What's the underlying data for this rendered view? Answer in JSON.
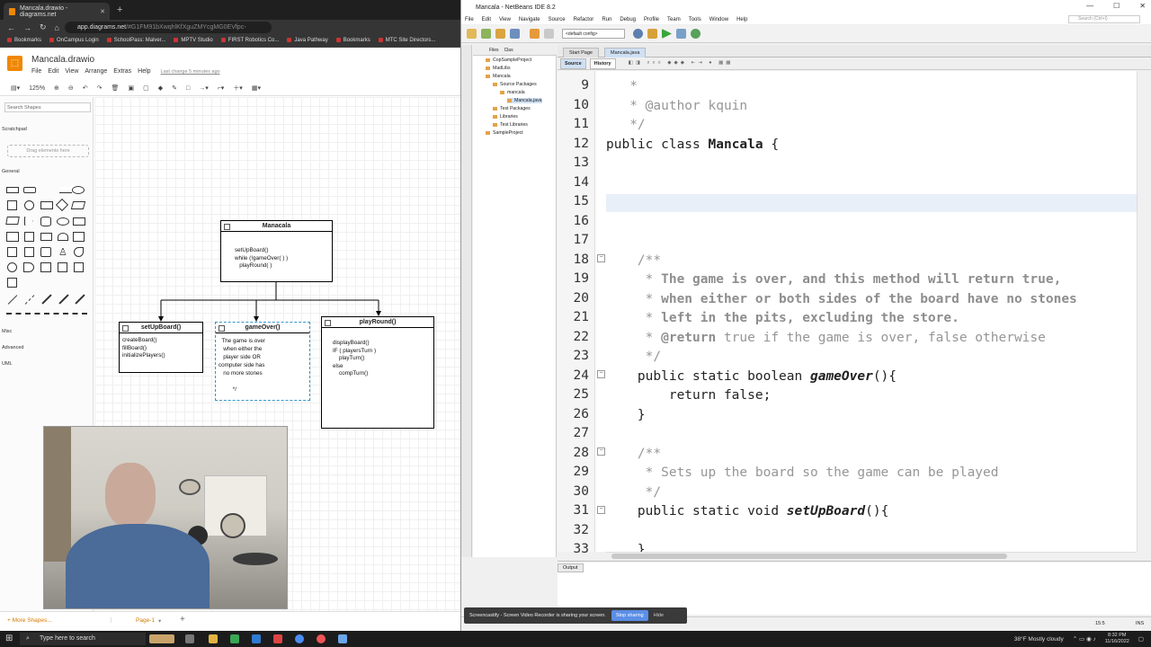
{
  "browser": {
    "tab_title": "Mancala.drawio - diagrams.net",
    "url_host": "app.diagrams.net",
    "url_rest": "/#G1FM91bXwqhlKfXguZMYcgMG0EVfpc-",
    "bookmarks": [
      "Bookmarks",
      "OnCampus Login",
      "SchoolPass: Malver...",
      "MPTV Studio",
      "FIRST Robotics Co...",
      "Java Pathway",
      "Bookmarks",
      "MTC Site Directors..."
    ]
  },
  "drawio": {
    "doc_title": "Mancala.drawio",
    "menu": [
      "File",
      "Edit",
      "View",
      "Arrange",
      "Extras",
      "Help"
    ],
    "last_change": "Last change 5 minutes ago",
    "zoom": "125%",
    "search_placeholder": "Search Shapes",
    "scratchpad": "Scratchpad",
    "drag_here": "Drag elements here",
    "general": "General",
    "misc": "Misc",
    "advanced": "Advanced",
    "uml": "UML",
    "more_shapes": "+ More Shapes...",
    "page": "Page-1",
    "boxes": {
      "main": {
        "title": "Manacala",
        "body": "setUpBoard()\nwhile (!gameOver( ) )\n   playRound( )"
      },
      "setup": {
        "title": "setUpBoard()",
        "body": "createBoard()\nfillBoard()\ninitializePlayers()"
      },
      "gameover": {
        "title": "gameOver()",
        "body": "  The game is over\n   when either the\n   player side OR\ncomputer side has\n   no more stones\n\n         */"
      },
      "playround": {
        "title": "playRound()",
        "body": "displayBoard()\nIF ( playersTurn )\n    playTurn()\nelse\n    compTurn()"
      }
    }
  },
  "netbeans": {
    "title": "Mancala - NetBeans IDE 8.2",
    "menu": [
      "File",
      "Edit",
      "View",
      "Navigate",
      "Source",
      "Refactor",
      "Run",
      "Debug",
      "Profile",
      "Team",
      "Tools",
      "Window",
      "Help"
    ],
    "search_placeholder": "Search (Ctrl+I)",
    "config": "<default config>",
    "panel_tabs": [
      "Files",
      "Clas"
    ],
    "tree": [
      "CopSampleProject",
      "MadLibs",
      "Mancala",
      "Source Packages",
      "mancala",
      "Mancala.java",
      "Test Packages",
      "Libraries",
      "Test Libraries",
      "SampleProject"
    ],
    "editor_tabs": [
      "Start Page",
      "Mancala.java"
    ],
    "source_btn": "Source",
    "history_btn": "History",
    "output_tab": "Output",
    "status_pos": "15:5",
    "status_ins": "INS",
    "code_lines": [
      {
        "n": "9",
        "t": "   *",
        "c": "cmt"
      },
      {
        "n": "10",
        "t": "   * @author kquin",
        "c": "cmt"
      },
      {
        "n": "11",
        "t": "   */",
        "c": "cmt"
      },
      {
        "n": "12",
        "t": "public class Mancala {",
        "c": "cls"
      },
      {
        "n": "13",
        "t": "",
        "c": ""
      },
      {
        "n": "14",
        "t": "",
        "c": ""
      },
      {
        "n": "15",
        "t": "",
        "c": "cur"
      },
      {
        "n": "16",
        "t": "",
        "c": ""
      },
      {
        "n": "17",
        "t": "",
        "c": ""
      },
      {
        "n": "18",
        "t": "    /**",
        "c": "cmt"
      },
      {
        "n": "19",
        "t": "     * The game is over, and this method will return true,",
        "c": "cmtb"
      },
      {
        "n": "20",
        "t": "     * when either or both sides of the board have no stones",
        "c": "cmtb"
      },
      {
        "n": "21",
        "t": "     * left in the pits, excluding the store.",
        "c": "cmtb"
      },
      {
        "n": "22",
        "t": "     * @return true if the game is over, false otherwise",
        "c": "ret"
      },
      {
        "n": "23",
        "t": "     */",
        "c": "cmt"
      },
      {
        "n": "24",
        "t": "    public static boolean gameOver(){",
        "c": "m1"
      },
      {
        "n": "25",
        "t": "        return false;",
        "c": "plain"
      },
      {
        "n": "26",
        "t": "    }",
        "c": "plain"
      },
      {
        "n": "27",
        "t": "",
        "c": ""
      },
      {
        "n": "28",
        "t": "    /**",
        "c": "cmt"
      },
      {
        "n": "29",
        "t": "     * Sets up the board so the game can be played",
        "c": "cmt"
      },
      {
        "n": "30",
        "t": "     */",
        "c": "cmt"
      },
      {
        "n": "31",
        "t": "    public static void setUpBoard(){",
        "c": "m2"
      },
      {
        "n": "32",
        "t": "",
        "c": ""
      },
      {
        "n": "33",
        "t": "    }",
        "c": "plain"
      }
    ]
  },
  "share_bar": {
    "text": "Screencastify - Screen Video Recorder is sharing your screen.",
    "stop": "Stop sharing",
    "hide": "Hide"
  },
  "taskbar": {
    "search": "Type here to search",
    "weather": "38°F  Mostly cloudy",
    "time": "8:32 PM",
    "date": "11/16/2022"
  }
}
